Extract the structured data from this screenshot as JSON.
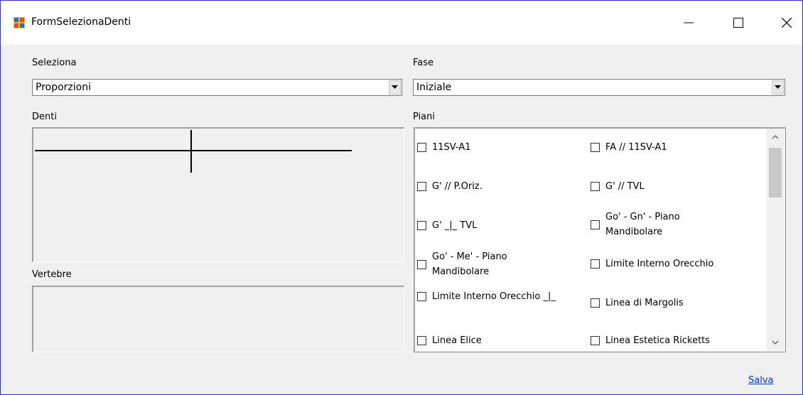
{
  "window": {
    "title": "FormSelezionaDenti",
    "icons": {
      "app": "app-form-icon",
      "minimize": "minimize-icon",
      "maximize": "maximize-icon",
      "close": "close-icon"
    }
  },
  "seleziona": {
    "label": "Seleziona",
    "value": "Proporzioni"
  },
  "fase": {
    "label": "Fase",
    "value": "Iniziale"
  },
  "denti": {
    "label": "Denti"
  },
  "vertebre": {
    "label": "Vertebre"
  },
  "piani": {
    "label": "Piani",
    "items": [
      {
        "label": "11SV-A1",
        "checked": false
      },
      {
        "label": "FA // 11SV-A1",
        "checked": false
      },
      {
        "label": "G' // P.Oriz.",
        "checked": false
      },
      {
        "label": "G' // TVL",
        "checked": false
      },
      {
        "label": "G' _|_ TVL",
        "checked": false
      },
      {
        "label": "Go' - Gn' - Piano Mandibolare",
        "checked": false
      },
      {
        "label": "Go' - Me' - Piano Mandibolare",
        "checked": false
      },
      {
        "label": "Limite Interno Orecchio",
        "checked": false
      },
      {
        "label": "Limite Interno Orecchio _|_",
        "checked": false
      },
      {
        "label": "Linea di Margolis",
        "checked": false
      },
      {
        "label": "Linea Elice",
        "checked": false
      },
      {
        "label": "Linea Estetica Ricketts",
        "checked": false
      }
    ]
  },
  "save_link": "Salva",
  "colors": {
    "window_border": "#2b2bd9",
    "link": "#0033cc",
    "background": "#f0f0f0"
  }
}
